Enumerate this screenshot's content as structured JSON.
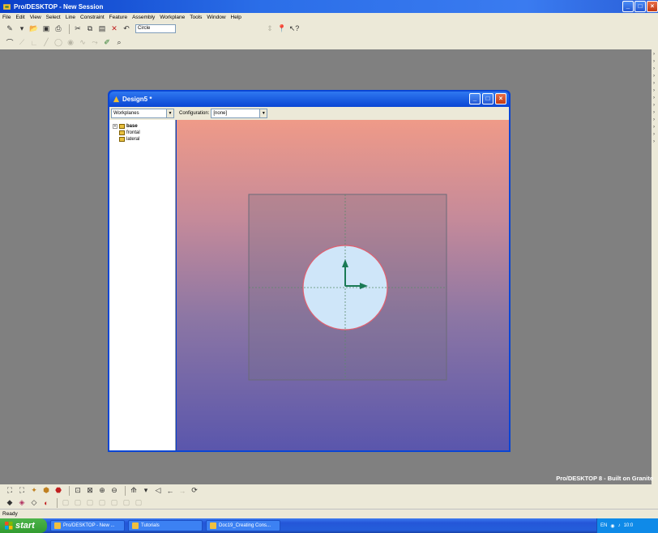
{
  "app": {
    "title": "Pro/DESKTOP - New Session",
    "window_buttons": [
      "_",
      "□",
      "×"
    ]
  },
  "menu": [
    "File",
    "Edit",
    "View",
    "Select",
    "Line",
    "Constraint",
    "Feature",
    "Assembly",
    "Workplane",
    "Tools",
    "Window",
    "Help"
  ],
  "toolbar": {
    "shape_select": "Circle"
  },
  "document": {
    "title": "Design5 *",
    "workplanes_select": "Workplanes",
    "configuration_label": "Configuration:",
    "configuration_value": "[none]",
    "tree": {
      "root": "base",
      "children": [
        "frontal",
        "lateral"
      ]
    }
  },
  "brand": "Pro/DESKTOP 8 - Built on Granite",
  "status": "Ready",
  "taskbar": {
    "start": "start",
    "tasks": [
      "Pro/DESKTOP - New ...",
      "Tutorials",
      "Doc19_Creating Cons..."
    ],
    "tray_lang": "EN",
    "clock": "10:0"
  },
  "colors": {
    "viewport_top": "#ef9a88",
    "viewport_bottom": "#5a56ac",
    "circle_fill": "#cfe6f9",
    "circle_stroke": "#e06070",
    "axis_color": "#1a7a55"
  }
}
